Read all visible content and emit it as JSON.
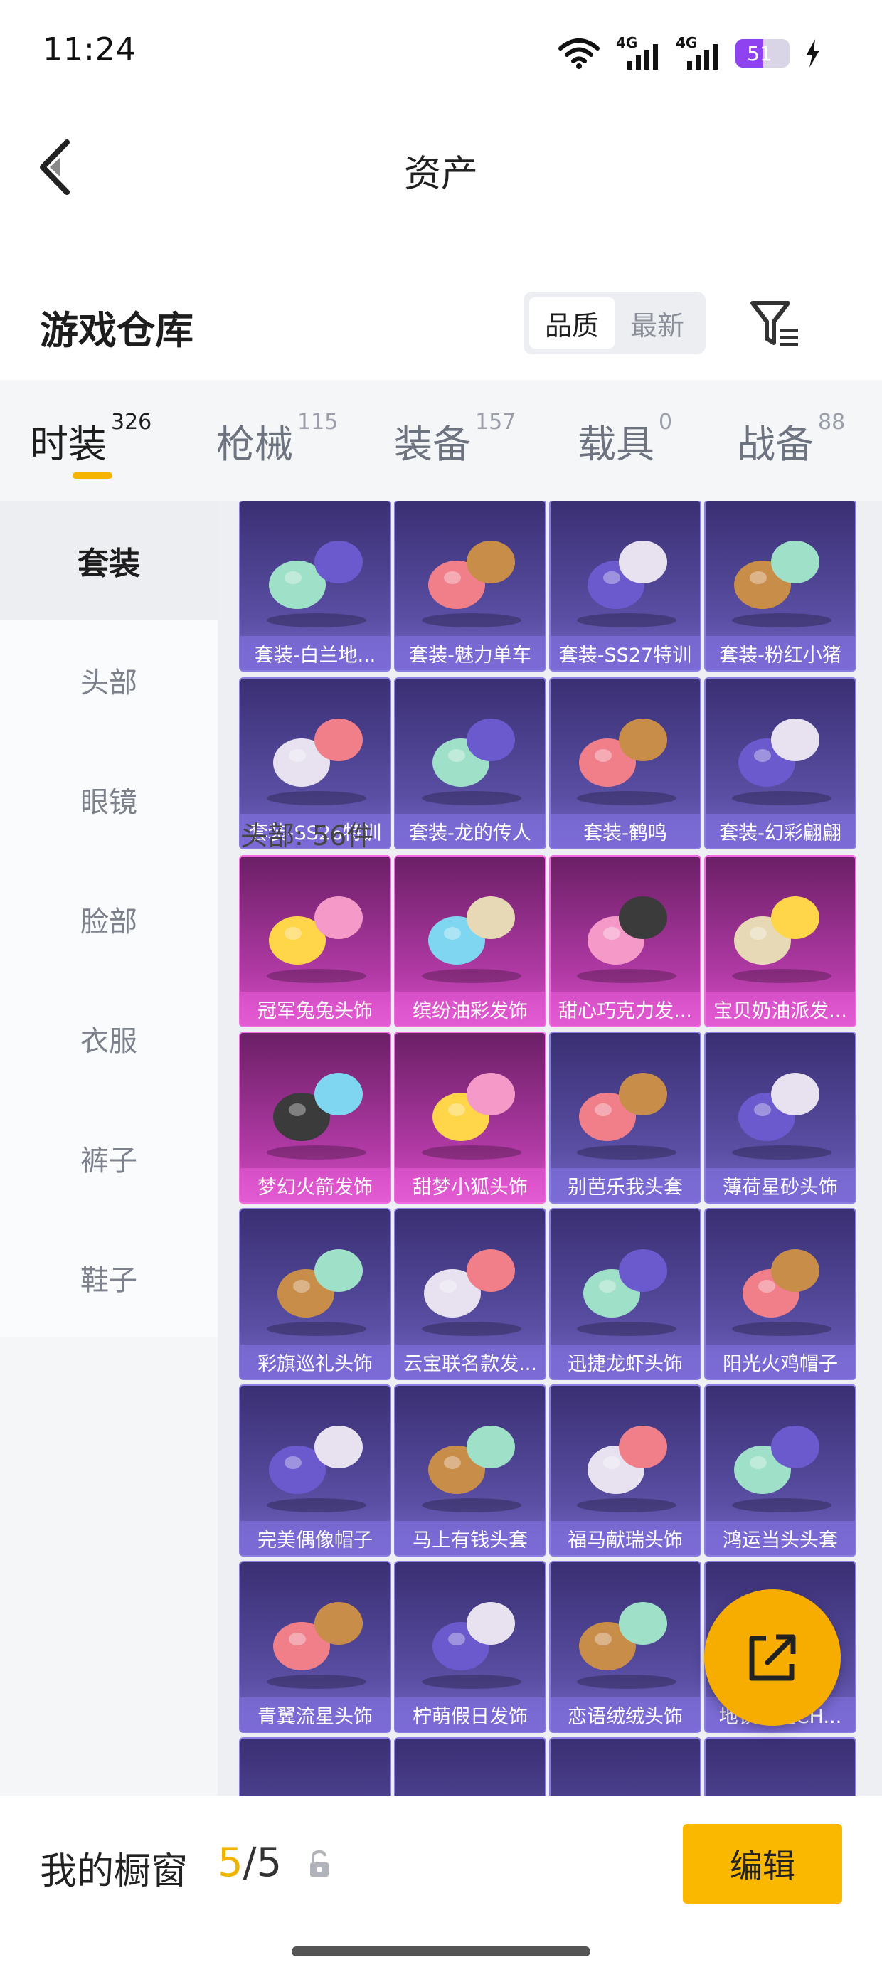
{
  "status": {
    "time": "11:24",
    "battery": "51",
    "battery_pct": 0.51,
    "net1": "4G",
    "net2": "4G"
  },
  "header": {
    "title": "资产"
  },
  "warehouse": {
    "title": "游戏仓库",
    "sort_options": [
      "品质",
      "最新"
    ],
    "active_sort": 0
  },
  "tabs": [
    {
      "label": "时装",
      "count": "326",
      "active": true
    },
    {
      "label": "枪械",
      "count": "115"
    },
    {
      "label": "装备",
      "count": "157"
    },
    {
      "label": "载具",
      "count": "0"
    },
    {
      "label": "战备",
      "count": "88"
    }
  ],
  "sidebar": [
    {
      "label": "套装",
      "active": true
    },
    {
      "label": "头部"
    },
    {
      "label": "眼镜"
    },
    {
      "label": "脸部"
    },
    {
      "label": "衣服"
    },
    {
      "label": "裤子"
    },
    {
      "label": "鞋子"
    }
  ],
  "outfits_partial": [
    "套装-白兰地...",
    "套装-魅力单车",
    "套装-SS27特训",
    "套装-粉红小猪"
  ],
  "outfits": [
    "套装-SS26特训",
    "套装-龙的传人",
    "套装-鹤鸣",
    "套装-幻彩翩翩"
  ],
  "head_section_label": "头部: 56件",
  "head_items": [
    {
      "name": "冠军兔兔头饰",
      "rarity": "pink"
    },
    {
      "name": "缤纷油彩发饰",
      "rarity": "pink"
    },
    {
      "name": "甜心巧克力发...",
      "rarity": "pink"
    },
    {
      "name": "宝贝奶油派发...",
      "rarity": "pink"
    },
    {
      "name": "梦幻火箭发饰",
      "rarity": "pink"
    },
    {
      "name": "甜梦小狐头饰",
      "rarity": "pink"
    },
    {
      "name": "别芭乐我头套",
      "rarity": "purple"
    },
    {
      "name": "薄荷星砂头饰",
      "rarity": "purple"
    },
    {
      "name": "彩旗巡礼头饰",
      "rarity": "purple"
    },
    {
      "name": "云宝联名款发...",
      "rarity": "purple"
    },
    {
      "name": "迅捷龙虾头饰",
      "rarity": "purple"
    },
    {
      "name": "阳光火鸡帽子",
      "rarity": "purple"
    },
    {
      "name": "完美偶像帽子",
      "rarity": "purple"
    },
    {
      "name": "马上有钱头套",
      "rarity": "purple"
    },
    {
      "name": "福马献瑞头饰",
      "rarity": "purple"
    },
    {
      "name": "鸿运当头头套",
      "rarity": "purple"
    },
    {
      "name": "青翼流星头饰",
      "rarity": "purple"
    },
    {
      "name": "柠萌假日发饰",
      "rarity": "purple"
    },
    {
      "name": "恋语绒绒头饰",
      "rarity": "purple"
    },
    {
      "name": "地铁逃生CH...",
      "rarity": "purple"
    }
  ],
  "showcase": {
    "label": "我的橱窗",
    "current": "5",
    "sep": "/",
    "total": "5",
    "edit_label": "编辑"
  },
  "colors": {
    "accent": "#f5b400",
    "purple_card": "#5a4fa4",
    "pink_card": "#b23aa6"
  }
}
